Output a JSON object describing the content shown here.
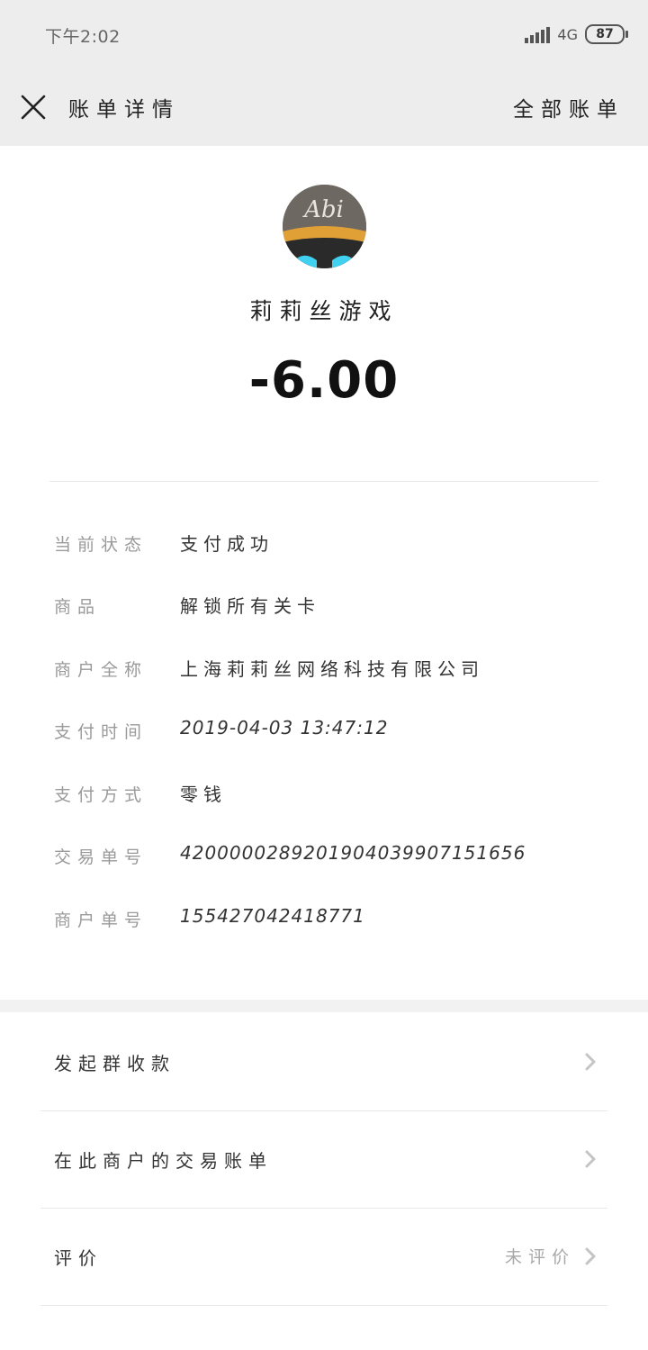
{
  "status_bar": {
    "time": "下午2:02",
    "network": "4G",
    "battery": "87"
  },
  "header": {
    "title": "账单详情",
    "all_bills": "全部账单"
  },
  "merchant": {
    "avatar_text": "Abi",
    "name": "莉莉丝游戏",
    "amount": "-6.00"
  },
  "details": [
    {
      "label": "当前状态",
      "value": "支付成功"
    },
    {
      "label": "商品",
      "value": "解锁所有关卡"
    },
    {
      "label": "商户全称",
      "value": "上海莉莉丝网络科技有限公司"
    },
    {
      "label": "支付时间",
      "value": "2019-04-03  13:47:12"
    },
    {
      "label": "支付方式",
      "value": "零钱"
    },
    {
      "label": "交易单号",
      "value": "4200000289201904039907151656"
    },
    {
      "label": "商户单号",
      "value": "155427042418771"
    }
  ],
  "actions": [
    {
      "label": "发起群收款",
      "sub": ""
    },
    {
      "label": "在此商户的交易账单",
      "sub": ""
    },
    {
      "label": "评价",
      "sub": "未评价"
    }
  ],
  "colors": {
    "header_bg": "#ededed",
    "label_gray": "#9a9a9a",
    "chevron_gray": "#c4c4c4",
    "avatar_bg": "#6b6560",
    "avatar_band": "#e0a035",
    "avatar_cyan": "#40d0f0"
  }
}
